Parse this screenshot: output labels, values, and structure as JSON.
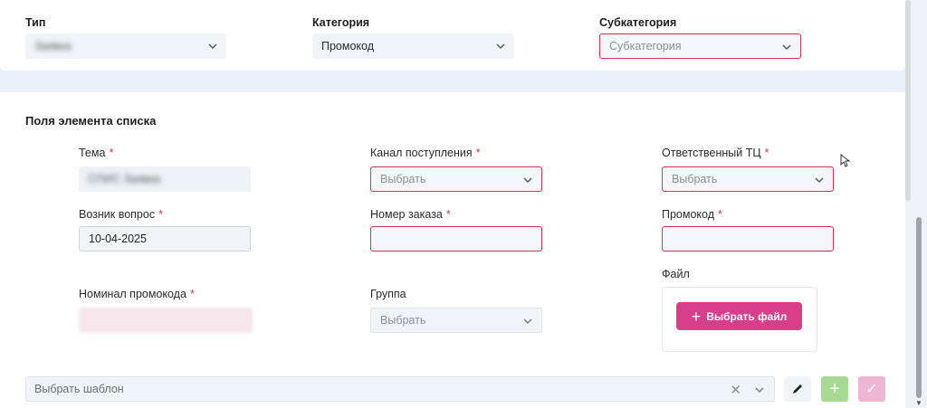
{
  "header": {
    "type_label": "Тип",
    "type_value": "Заявка",
    "category_label": "Категория",
    "category_value": "Промокод",
    "subcategory_label": "Субкатегория",
    "subcategory_placeholder": "Субкатегория"
  },
  "section": {
    "title": "Поля элемента списка"
  },
  "fields": {
    "topic_label": "Тема",
    "topic_value": "СПИС Заявка",
    "channel_label": "Канал поступления",
    "channel_placeholder": "Выбрать",
    "responsible_label": "Ответственный ТЦ",
    "responsible_placeholder": "Выбрать",
    "question_date_label": "Возник вопрос",
    "question_date_value": "10-04-2025",
    "order_number_label": "Номер заказа",
    "order_number_value": "",
    "promo_label": "Промокод",
    "promo_value": "",
    "nominal_label": "Номинал промокода",
    "nominal_value": "",
    "group_label": "Группа",
    "group_placeholder": "Выбрать",
    "file_label": "Файл",
    "file_button": "Выбрать файл"
  },
  "template": {
    "placeholder": "Выбрать шаблон"
  },
  "colors": {
    "error": "#d8334a",
    "file_button": "#d93e8a",
    "add_button": "#a7d992",
    "confirm_button": "#eeb6d3"
  },
  "icons": {
    "chevron": "chevron-down-icon",
    "clear": "clear-icon",
    "edit": "pencil-icon",
    "add": "plus-icon",
    "confirm": "check-icon"
  }
}
